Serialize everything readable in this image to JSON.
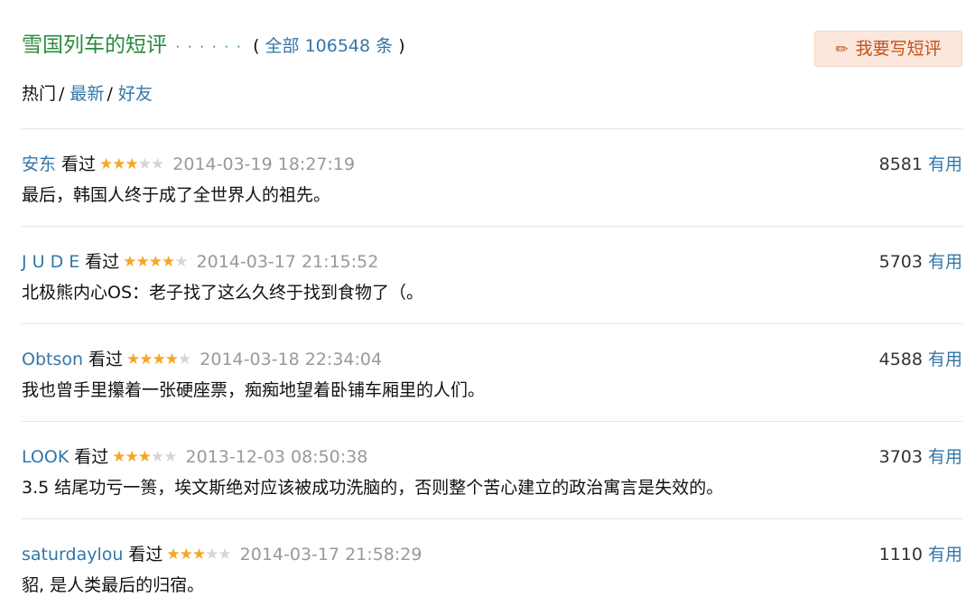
{
  "header": {
    "title": "雪国列车的短评",
    "dots": "· · · · · ·",
    "count_open": "( ",
    "count_label": "全部 106548 条",
    "count_close": " )",
    "write_button": "我要写短评",
    "write_icon": "pencil-icon"
  },
  "tabs": {
    "hot": "热门",
    "latest": "最新",
    "friends": "好友",
    "separator": "/"
  },
  "watched_label": "看过",
  "useful_label": "有用",
  "colors": {
    "accent_green": "#2a8a3c",
    "link_blue": "#3377aa",
    "star_on": "#f5a623",
    "star_off": "#d6d6d6",
    "button_bg": "#fbe7dc",
    "button_text": "#c0521b"
  },
  "comments": [
    {
      "user": "安东",
      "rating": 3,
      "time": "2014-03-19 18:27:19",
      "votes": "8581",
      "text": "最后，韩国人终于成了全世界人的祖先。"
    },
    {
      "user": "J U D E",
      "rating": 4,
      "time": "2014-03-17 21:15:52",
      "votes": "5703",
      "text": "北极熊内心OS：老子找了这么久终于找到食物了（。"
    },
    {
      "user": "Obtson",
      "rating": 4,
      "time": "2014-03-18 22:34:04",
      "votes": "4588",
      "text": "我也曾手里攥着一张硬座票，痴痴地望着卧铺车厢里的人们。"
    },
    {
      "user": "LOOK",
      "rating": 3,
      "time": "2013-12-03 08:50:38",
      "votes": "3703",
      "text": "3.5 结尾功亏一篑，埃文斯绝对应该被成功洗脑的，否则整个苦心建立的政治寓言是失效的。"
    },
    {
      "user": "saturdaylou",
      "rating": 3,
      "time": "2014-03-17 21:58:29",
      "votes": "1110",
      "text": "貂, 是人类最后的归宿。"
    }
  ]
}
